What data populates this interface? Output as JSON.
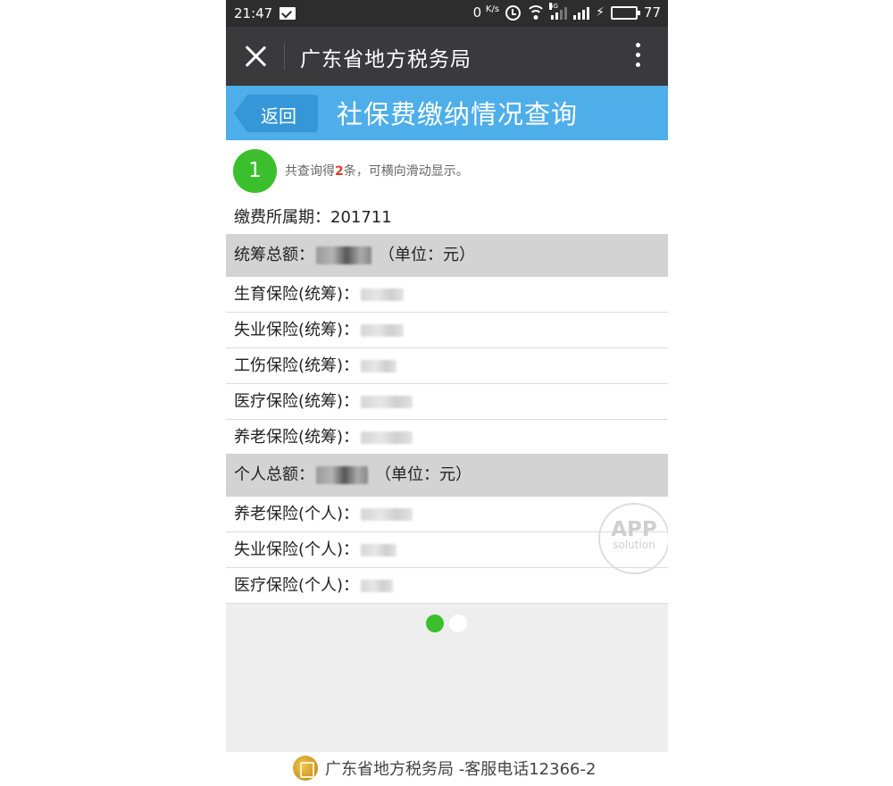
{
  "status_bar": {
    "time": "21:47",
    "speed_value": "0",
    "speed_unit": "K/s",
    "network_label": "4G",
    "battery_level": "77",
    "battery_fill": 0.77,
    "battery_color": "#4cd137"
  },
  "titlebar": {
    "title": "广东省地方税务局",
    "close_icon": "close-icon",
    "more_icon": "more-vertical-icon"
  },
  "header": {
    "back_label": "返回",
    "title": "社保费缴纳情况查询",
    "color": "#4eaee9"
  },
  "summary": {
    "page_number": "1",
    "prefix": "共查询得",
    "count": "2",
    "suffix": "条，可横向滑动显示。"
  },
  "period": {
    "label": "缴费所属期：",
    "value": "201711"
  },
  "pooled": {
    "label": "统筹总额：",
    "unit": "（单位：元）",
    "items": [
      {
        "label": "生育保险(统筹)："
      },
      {
        "label": "失业保险(统筹)："
      },
      {
        "label": "工伤保险(统筹)："
      },
      {
        "label": "医疗保险(统筹)："
      },
      {
        "label": "养老保险(统筹)："
      }
    ]
  },
  "personal": {
    "label": "个人总额：",
    "unit": "（单位：元）",
    "items": [
      {
        "label": "养老保险(个人)："
      },
      {
        "label": "失业保险(个人)："
      },
      {
        "label": "医疗保险(个人)："
      }
    ]
  },
  "watermark": {
    "line1": "APP",
    "line2": "solution"
  },
  "pager": {
    "total": 2,
    "current": 1,
    "active_color": "#3cbf2c"
  },
  "footer": {
    "text": "广东省地方税务局 -客服电话12366-2"
  }
}
